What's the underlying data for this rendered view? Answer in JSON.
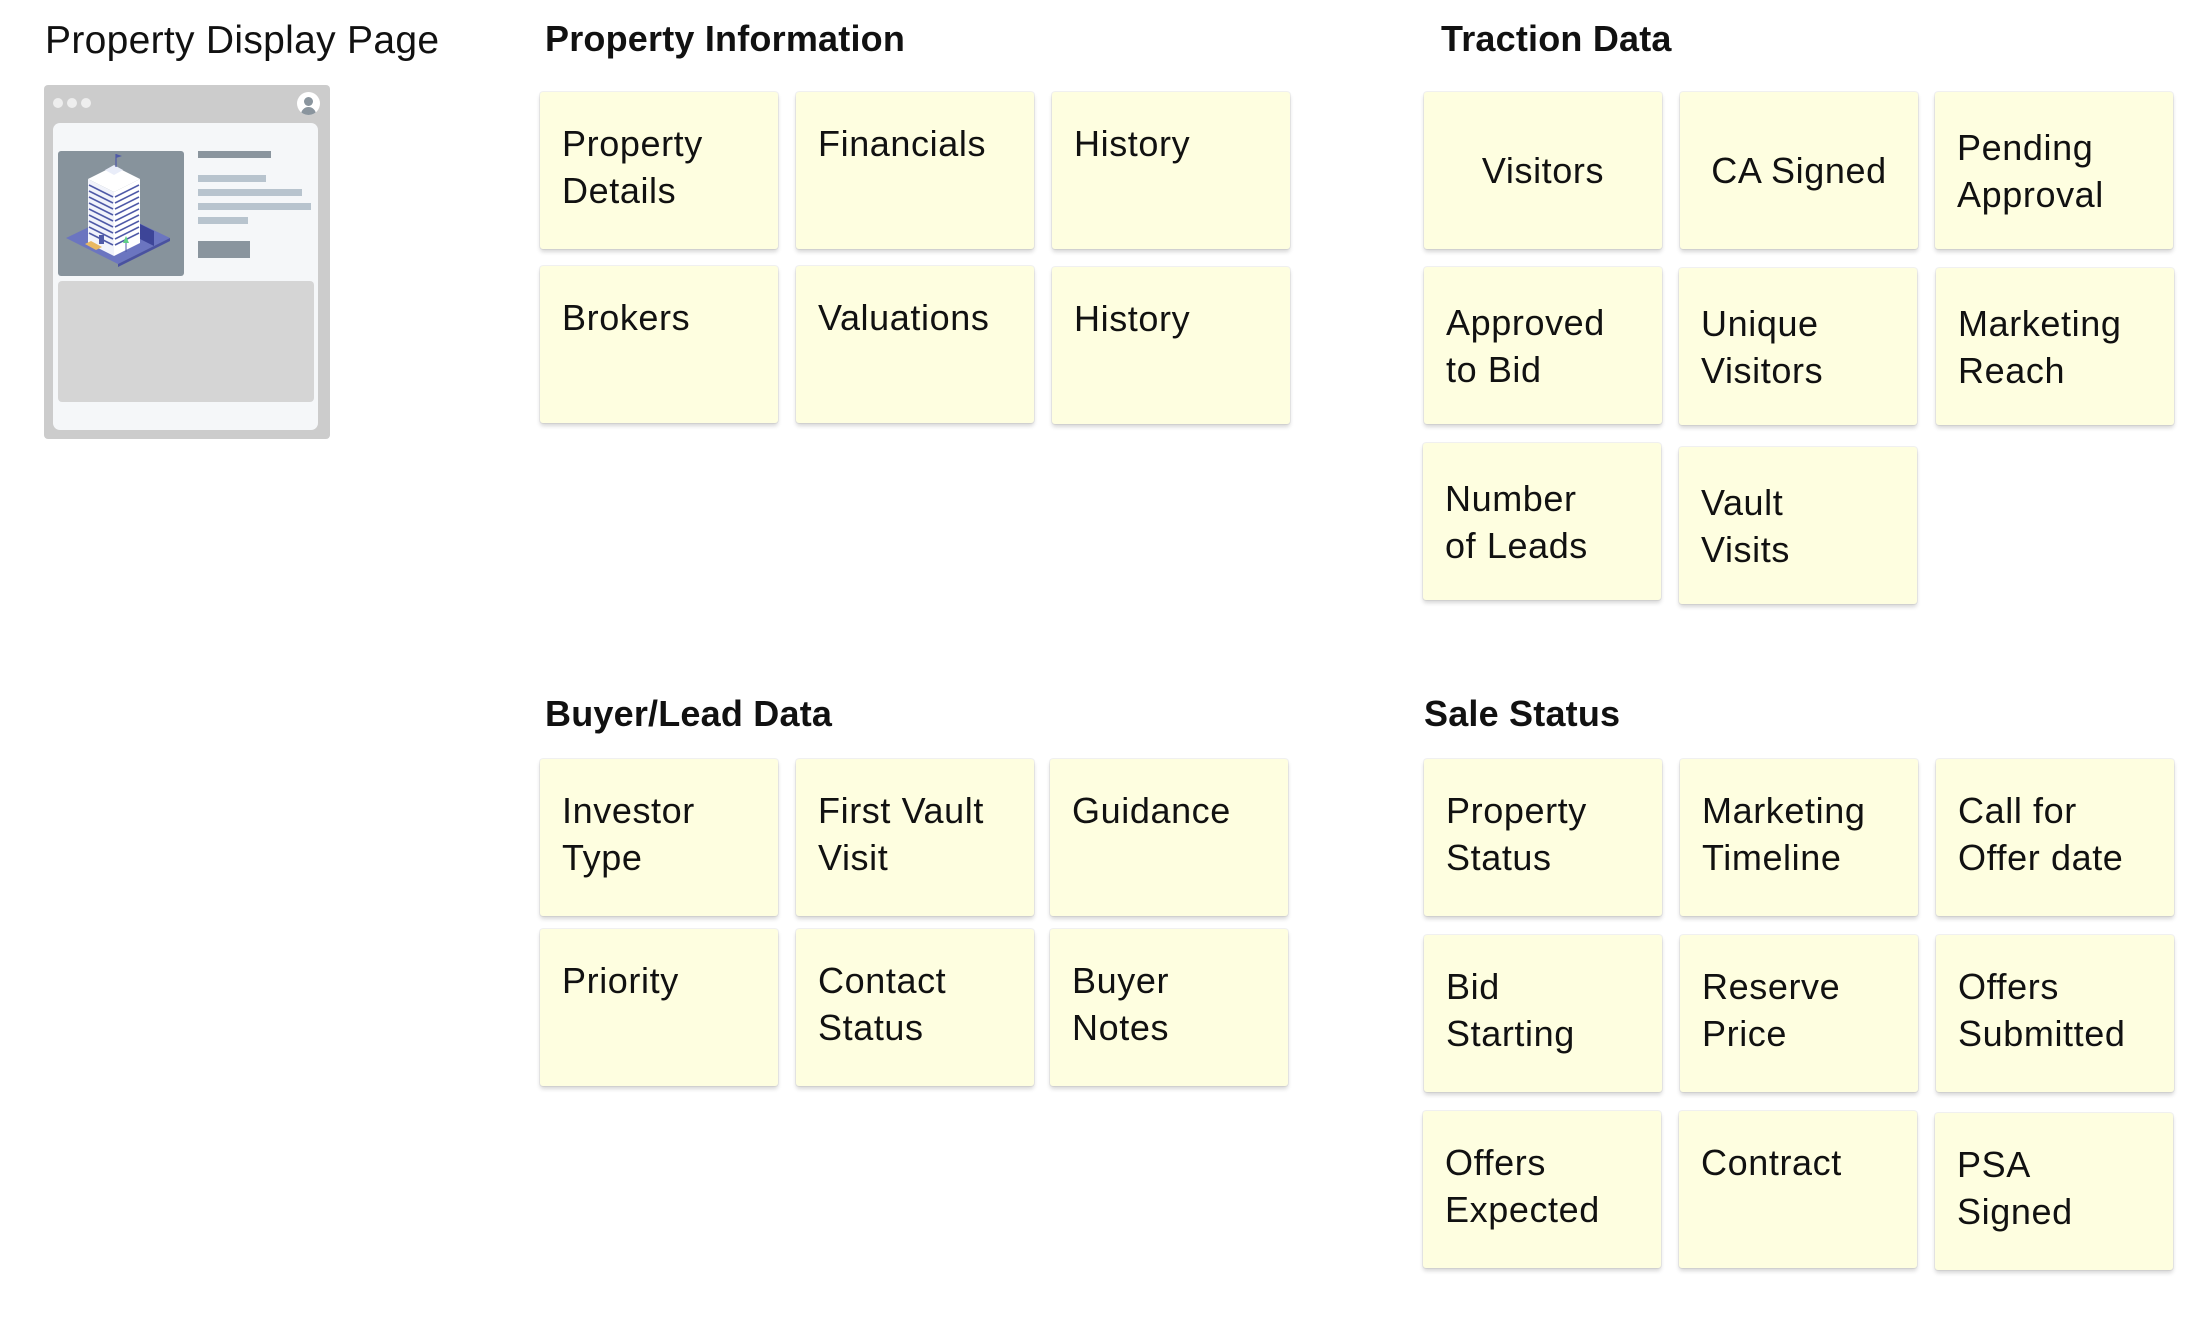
{
  "page_title": "Property Display Page",
  "wireframe": {
    "label": "property-page-thumbnail",
    "colors": {
      "frame": "#cccccc",
      "panel": "#f5f7f9",
      "image_bg": "#87939c",
      "bar": "#b8c4ce",
      "bar_dark": "#8a959e",
      "building_base": "#6b75c0"
    }
  },
  "sections": {
    "property_information": {
      "title": "Property Information",
      "cards": [
        "Property\nDetails",
        "Financials",
        "History",
        "Brokers",
        "Valuations",
        "History"
      ]
    },
    "traction_data": {
      "title": "Traction Data",
      "cards": [
        "Visitors",
        "CA Signed",
        "Pending\nApproval",
        "Approved\nto Bid",
        "Unique\nVisitors",
        "Marketing\nReach",
        "Number\nof Leads",
        "Vault\nVisits"
      ]
    },
    "buyer_lead_data": {
      "title": "Buyer/Lead Data",
      "cards": [
        "Investor\nType",
        "First Vault\nVisit",
        "Guidance",
        "Priority",
        "Contact\nStatus",
        "Buyer\nNotes"
      ]
    },
    "sale_status": {
      "title": "Sale Status",
      "cards": [
        "Property\nStatus",
        "Marketing\nTimeline",
        "Call for\nOffer date",
        "Bid\nStarting",
        "Reserve\nPrice",
        "Offers\nSubmitted",
        "Offers\nExpected",
        "Contract",
        "PSA\nSigned"
      ]
    }
  },
  "colors": {
    "sticky_note": "#fefee0",
    "text": "#111111",
    "background": "#ffffff"
  }
}
